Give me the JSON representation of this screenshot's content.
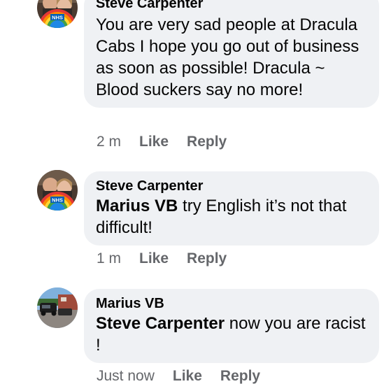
{
  "comments": [
    {
      "author": "Steve Carpenter",
      "mention": "",
      "text": "You are very sad people at Dracula Cabs I hope you go out of business as soon as possible! Dracula ~ Blood suckers say no more!",
      "time": "2 m",
      "like_label": "Like",
      "reply_label": "Reply",
      "avatar": "profile-photo-two-people-nhs-rainbow",
      "avatar_badge": "NHS"
    },
    {
      "author": "Steve Carpenter",
      "mention": "Marius VB",
      "text": " try English it’s not that difficult!",
      "time": "1 m",
      "like_label": "Like",
      "reply_label": "Reply",
      "avatar": "profile-photo-two-people-nhs-rainbow",
      "avatar_badge": "NHS"
    },
    {
      "author": "Marius VB",
      "mention": "Steve Carpenter",
      "text": " now you are racist !",
      "time": "Just now",
      "like_label": "Like",
      "reply_label": "Reply",
      "avatar": "profile-photo-cars-driveway"
    }
  ],
  "colors": {
    "bubble_bg": "#eff1f4",
    "meta_text": "#65676b",
    "body_text": "#050505"
  }
}
